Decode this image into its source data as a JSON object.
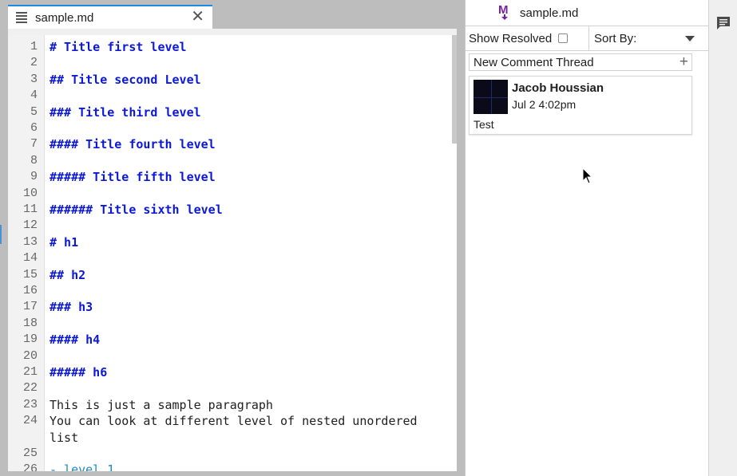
{
  "editor": {
    "tab_label": "sample.md",
    "tab_close": "✕",
    "lines": [
      {
        "num": "1",
        "text": "# Title first level",
        "kind": "h"
      },
      {
        "num": "2",
        "text": "",
        "kind": "t"
      },
      {
        "num": "3",
        "text": "## Title second Level",
        "kind": "h"
      },
      {
        "num": "4",
        "text": "",
        "kind": "t"
      },
      {
        "num": "5",
        "text": "### Title third level",
        "kind": "h"
      },
      {
        "num": "6",
        "text": "",
        "kind": "t"
      },
      {
        "num": "7",
        "text": "#### Title fourth level",
        "kind": "h"
      },
      {
        "num": "8",
        "text": "",
        "kind": "t"
      },
      {
        "num": "9",
        "text": "##### Title fifth level",
        "kind": "h"
      },
      {
        "num": "10",
        "text": "",
        "kind": "t"
      },
      {
        "num": "11",
        "text": "###### Title sixth level",
        "kind": "h"
      },
      {
        "num": "12",
        "text": "",
        "kind": "t"
      },
      {
        "num": "13",
        "text": "# h1",
        "kind": "h"
      },
      {
        "num": "14",
        "text": "",
        "kind": "t"
      },
      {
        "num": "15",
        "text": "## h2",
        "kind": "h"
      },
      {
        "num": "16",
        "text": "",
        "kind": "t"
      },
      {
        "num": "17",
        "text": "### h3",
        "kind": "h"
      },
      {
        "num": "18",
        "text": "",
        "kind": "t"
      },
      {
        "num": "19",
        "text": "#### h4",
        "kind": "h"
      },
      {
        "num": "20",
        "text": "",
        "kind": "t"
      },
      {
        "num": "21",
        "text": "##### h6",
        "kind": "h"
      },
      {
        "num": "22",
        "text": "",
        "kind": "t"
      },
      {
        "num": "23",
        "text": "This is just a sample paragraph",
        "kind": "t"
      },
      {
        "num": "24",
        "text": "You can look at different level of nested unordered",
        "kind": "t"
      },
      {
        "num": "",
        "text": "list",
        "kind": "t"
      },
      {
        "num": "25",
        "text": "",
        "kind": "t"
      },
      {
        "num": "26",
        "text": "- level 1",
        "kind": "list"
      }
    ]
  },
  "comments": {
    "file_name": "sample.md",
    "show_resolved_label": "Show Resolved",
    "sort_by_label": "Sort By:",
    "new_thread_label": "New Comment Thread",
    "new_thread_plus": "+",
    "thread": {
      "author": "Jacob Houssian",
      "timestamp": "Jul 2 4:02pm",
      "text": "Test"
    }
  },
  "colors": {
    "accent": "#1e88e5",
    "heading": "#0b18d8",
    "logo": "#7b1fa2"
  },
  "icons": [
    "document-icon",
    "close-icon",
    "m-logo-icon",
    "checkbox-icon",
    "chevron-down-icon",
    "plus-icon",
    "comment-icon",
    "cursor-icon"
  ]
}
